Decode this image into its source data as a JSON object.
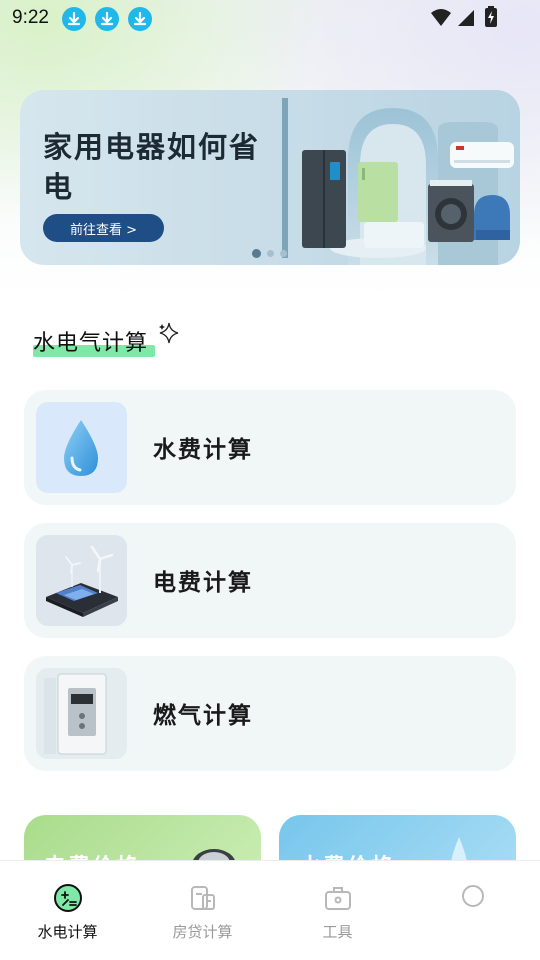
{
  "status_bar": {
    "time": "9:22",
    "download_icons": [
      "download-icon",
      "download-icon",
      "download-icon"
    ],
    "system_icons": [
      "wifi-icon",
      "signal-icon",
      "battery-charging-icon"
    ]
  },
  "banner": {
    "title": "家用电器如何省电",
    "button_label": "前往查看 >",
    "page_count": 3,
    "active_page": 1
  },
  "section": {
    "title": "水电气计算"
  },
  "calculators": [
    {
      "label": "水费计算",
      "icon": "water-drop-icon"
    },
    {
      "label": "电费计算",
      "icon": "solar-wind-icon"
    },
    {
      "label": "燃气计算",
      "icon": "gas-heater-icon"
    }
  ],
  "price_cards": [
    {
      "label": "电费价格",
      "color": "#a9dc8c"
    },
    {
      "label": "水费价格",
      "color": "#77c6ec"
    }
  ],
  "bottom_nav": {
    "items": [
      {
        "label": "水电计算",
        "icon": "calculator-icon",
        "active": true
      },
      {
        "label": "房贷计算",
        "icon": "building-icon",
        "active": false
      },
      {
        "label": "工具",
        "icon": "toolbox-icon",
        "active": false
      },
      {
        "label": "",
        "icon": "profile-icon",
        "active": false
      }
    ]
  },
  "colors": {
    "accent": "#1f4d86",
    "highlight": "#7fe8a6",
    "card_bg": "#f0f7f6"
  }
}
